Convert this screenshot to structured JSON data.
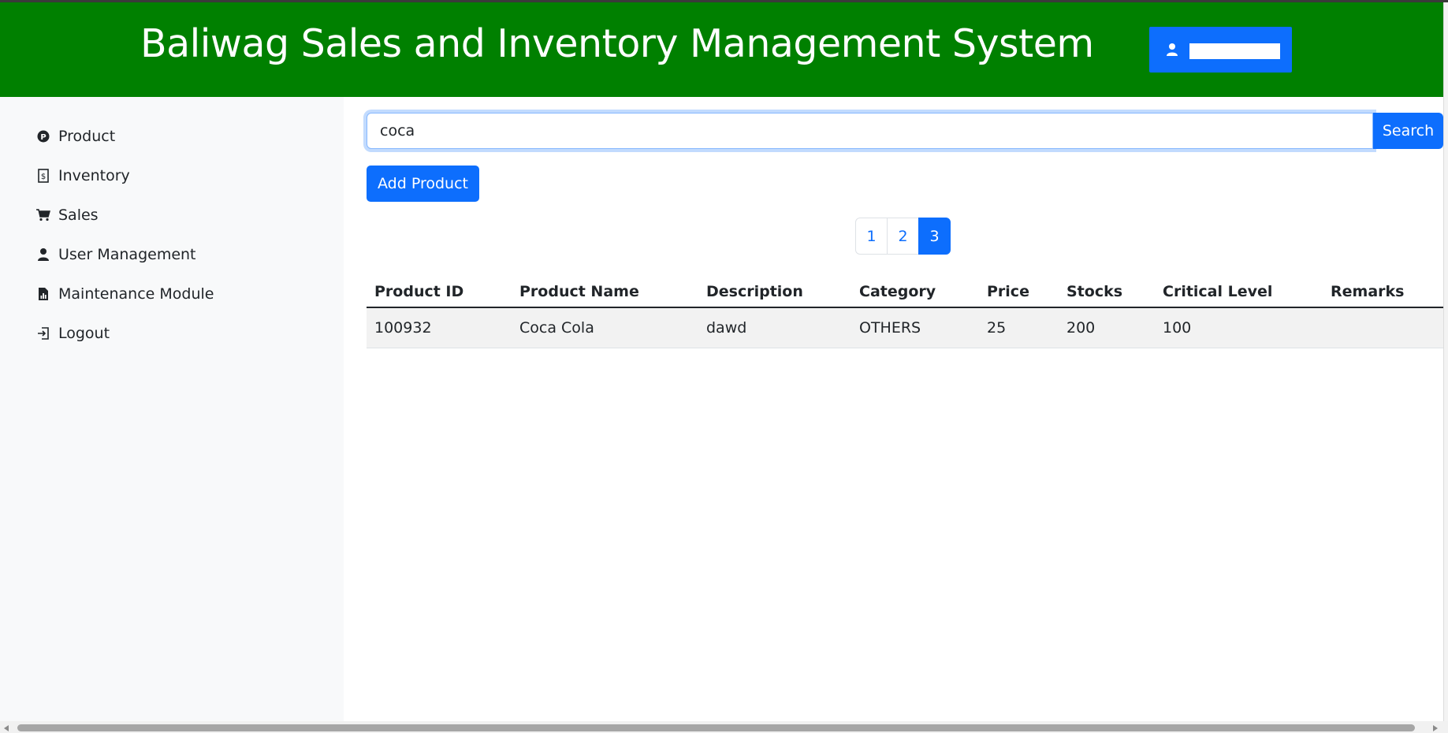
{
  "header": {
    "title": "Baliwag Sales and Inventory Management System",
    "user_icon": "user-icon",
    "accent": "#008000"
  },
  "sidebar": {
    "items": [
      {
        "label": "Product",
        "icon": "product-icon"
      },
      {
        "label": "Inventory",
        "icon": "inventory-icon"
      },
      {
        "label": "Sales",
        "icon": "cart-icon"
      },
      {
        "label": "User Management",
        "icon": "user-icon"
      },
      {
        "label": "Maintenance Module",
        "icon": "report-icon"
      },
      {
        "label": "Logout",
        "icon": "logout-icon"
      }
    ]
  },
  "search": {
    "value": "coca",
    "button_label": "Search"
  },
  "actions": {
    "add_product_label": "Add Product"
  },
  "pagination": {
    "pages": [
      "1",
      "2",
      "3"
    ],
    "active": "3"
  },
  "table": {
    "columns": [
      "Product ID",
      "Product Name",
      "Description",
      "Category",
      "Price",
      "Stocks",
      "Critical Level",
      "Remarks"
    ],
    "rows": [
      [
        "100932",
        "Coca Cola",
        "dawd",
        "OTHERS",
        "25",
        "200",
        "100",
        ""
      ]
    ]
  },
  "colors": {
    "primary": "#0d6efd",
    "header_bg": "#008000",
    "sidebar_bg": "#f8f9fa"
  }
}
